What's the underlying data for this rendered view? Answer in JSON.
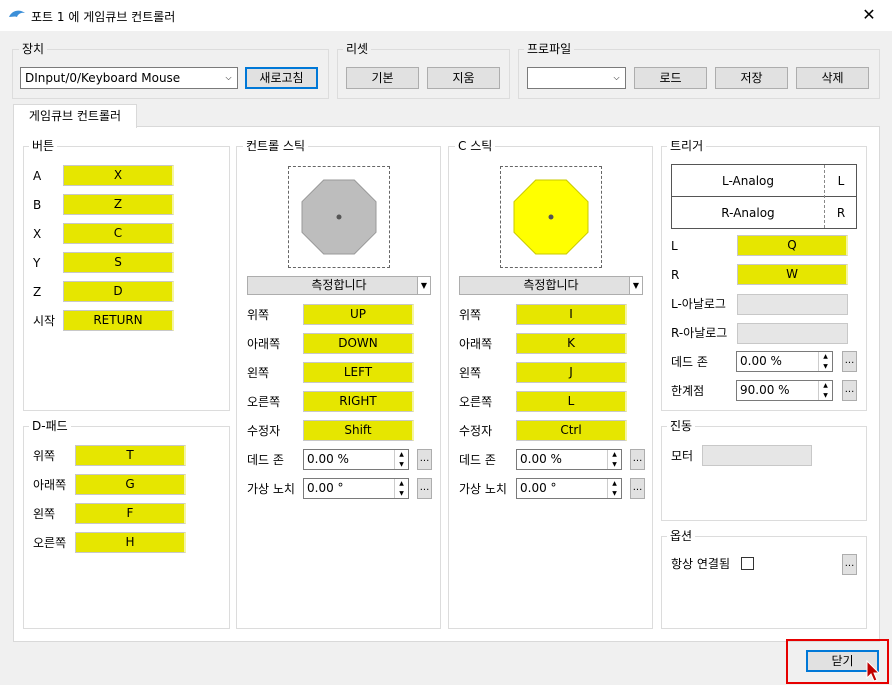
{
  "window": {
    "title": "포트 1 에 게임큐브 컨트롤러",
    "close_glyph": "✕"
  },
  "device": {
    "label": "장치",
    "value": "DInput/0/Keyboard Mouse",
    "refresh": "새로고침"
  },
  "preset": {
    "label": "리셋",
    "default": "기본",
    "clear": "지움"
  },
  "profile": {
    "label": "프로파일",
    "value": "",
    "load": "로드",
    "save": "저장",
    "delete": "삭제"
  },
  "tab": {
    "label": "게임큐브 컨트롤러"
  },
  "buttons": {
    "label": "버튼",
    "items": [
      {
        "name": "A",
        "key": "X"
      },
      {
        "name": "B",
        "key": "Z"
      },
      {
        "name": "X",
        "key": "C"
      },
      {
        "name": "Y",
        "key": "S"
      },
      {
        "name": "Z",
        "key": "D"
      },
      {
        "name": "시작",
        "key": "RETURN"
      }
    ]
  },
  "dpad": {
    "label": "D-패드",
    "items": [
      {
        "name": "위쪽",
        "key": "T"
      },
      {
        "name": "아래쪽",
        "key": "G"
      },
      {
        "name": "왼쪽",
        "key": "F"
      },
      {
        "name": "오른쪽",
        "key": "H"
      }
    ]
  },
  "main_stick": {
    "label": "컨트롤 스틱",
    "calibrate": "측정합니다",
    "items": [
      {
        "name": "위쪽",
        "key": "UP"
      },
      {
        "name": "아래쪽",
        "key": "DOWN"
      },
      {
        "name": "왼쪽",
        "key": "LEFT"
      },
      {
        "name": "오른쪽",
        "key": "RIGHT"
      },
      {
        "name": "수정자",
        "key": "Shift"
      }
    ],
    "dead_zone_label": "데드 존",
    "dead_zone": "0.00 %",
    "virtual_notch_label": "가상 노치",
    "virtual_notch": "0.00 °",
    "color": "#bdbdbd"
  },
  "c_stick": {
    "label": "C 스틱",
    "calibrate": "측정합니다",
    "items": [
      {
        "name": "위쪽",
        "key": "I"
      },
      {
        "name": "아래쪽",
        "key": "K"
      },
      {
        "name": "왼쪽",
        "key": "J"
      },
      {
        "name": "오른쪽",
        "key": "L"
      },
      {
        "name": "수정자",
        "key": "Ctrl"
      }
    ],
    "dead_zone_label": "데드 존",
    "dead_zone": "0.00 %",
    "virtual_notch_label": "가상 노치",
    "virtual_notch": "0.00 °",
    "color": "#ffff00"
  },
  "triggers": {
    "label": "트리거",
    "l_analog": "L-Analog",
    "l": "L",
    "r_analog": "R-Analog",
    "r": "R",
    "l_label": "L",
    "l_key": "Q",
    "r_label": "R",
    "r_key": "W",
    "l_analog_label": "L-아날로그",
    "r_analog_label": "R-아날로그",
    "dead_zone_label": "데드 존",
    "dead_zone": "0.00 %",
    "threshold_label": "한계점",
    "threshold": "90.00 %"
  },
  "rumble": {
    "label": "진동",
    "motor_label": "모터"
  },
  "options": {
    "label": "옵션",
    "always_connected": "항상 연결됨"
  },
  "footer": {
    "close": "닫기"
  },
  "ellipsis": "...",
  "highlight_color": "#e60000"
}
